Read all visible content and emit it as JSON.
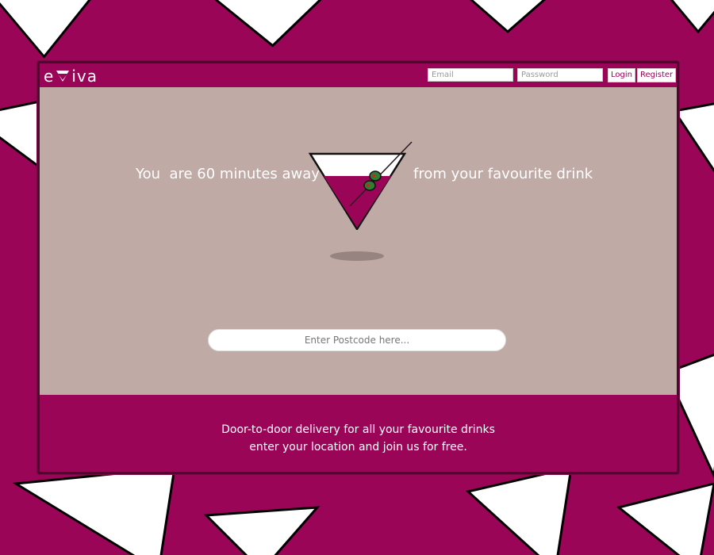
{
  "brand": {
    "logo_left": "e",
    "logo_right": "iva",
    "colors": {
      "primary": "#9b0558",
      "hero_bg": "#bfaaa5",
      "outline_dark": "#4a0a2d",
      "olive": "#2e7d32"
    }
  },
  "header": {
    "email_placeholder": "Email",
    "password_placeholder": "Password",
    "login_label": "Login",
    "register_label": "Register"
  },
  "hero": {
    "text_left": "You  are 60 minutes away",
    "text_right": "from your favourite drink",
    "illustration": "martini-glass-icon"
  },
  "search": {
    "placeholder": "Enter Postcode here..."
  },
  "footer": {
    "line1": "Door-to-door delivery for all your favourite drinks",
    "line2": "enter your location and join us for free."
  }
}
